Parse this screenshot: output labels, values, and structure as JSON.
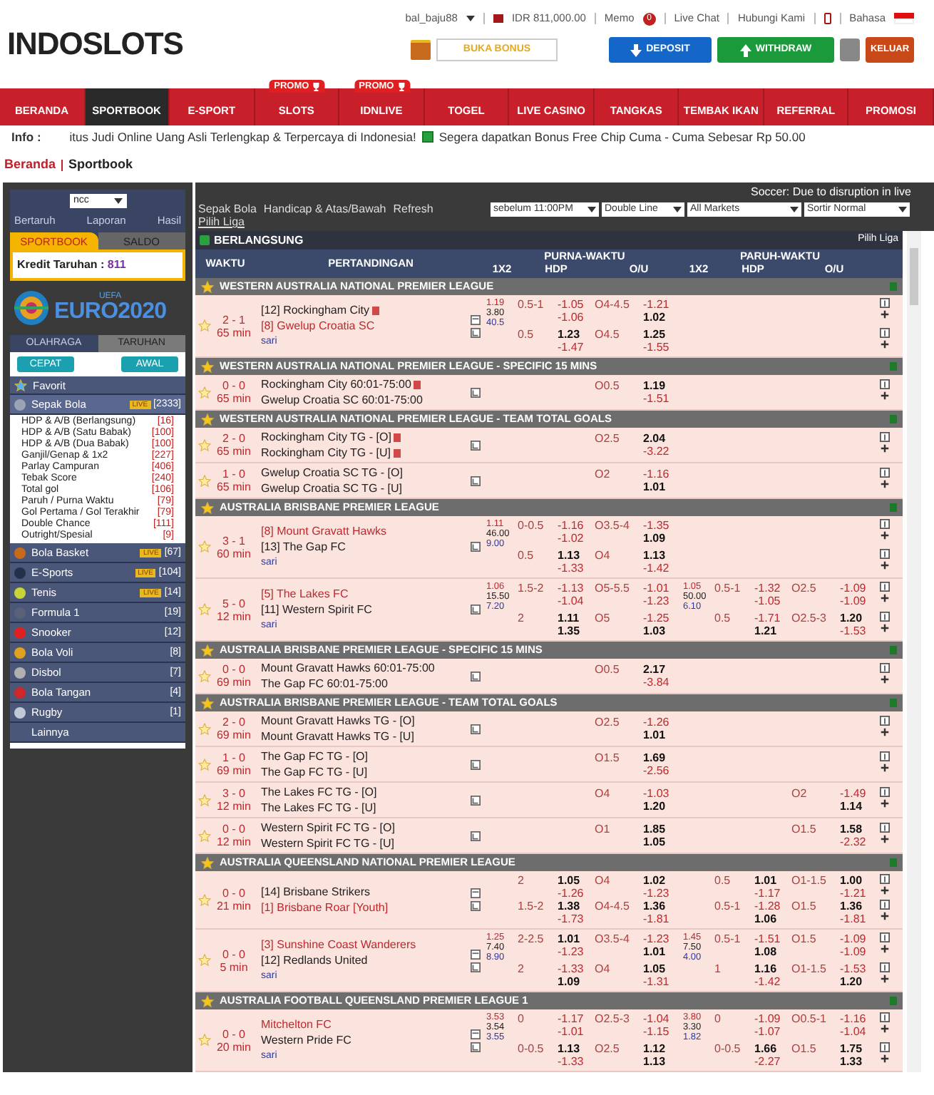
{
  "header": {
    "logo": "INDOSLOTS",
    "user": "bal_baju88",
    "balance": "IDR 811,000.00",
    "memo": {
      "label": "Memo",
      "count": "0"
    },
    "links": [
      "Live Chat",
      "Hubungi Kami"
    ],
    "language": "Bahasa",
    "bonus_button": "BUKA BONUS",
    "deposit_button": "DEPOSIT",
    "withdraw_button": "WITHDRAW",
    "logout_button": "KELUAR"
  },
  "nav": [
    {
      "label": "BERANDA",
      "selected": false
    },
    {
      "label": "SPORTBOOK",
      "selected": true
    },
    {
      "label": "E-SPORT",
      "selected": false
    },
    {
      "label": "SLOTS",
      "selected": false,
      "promo": "PROMO"
    },
    {
      "label": "IDNLIVE",
      "selected": false,
      "promo": "PROMO"
    },
    {
      "label": "TOGEL",
      "selected": false
    },
    {
      "label": "LIVE CASINO",
      "selected": false
    },
    {
      "label": "TANGKAS",
      "selected": false
    },
    {
      "label": "TEMBAK IKAN",
      "selected": false
    },
    {
      "label": "REFERRAL",
      "selected": false
    },
    {
      "label": "PROMOSI",
      "selected": false
    }
  ],
  "info": {
    "label": "Info :",
    "messages": [
      "itus Judi Online Uang Asli Terlengkap & Terpercaya di Indonesia!",
      "Segera dapatkan Bonus Free Chip Cuma - Cuma Sebesar Rp 50.00"
    ]
  },
  "breadcrumb": [
    "Beranda",
    "Sportbook"
  ],
  "sidebar": {
    "odds_type": "ncc",
    "links": [
      "Bertaruh",
      "Laporan",
      "Hasil"
    ],
    "tabs": [
      {
        "label": "SPORTBOOK",
        "selected": true
      },
      {
        "label": "SALDO",
        "selected": false
      }
    ],
    "credit_label": "Kredit Taruhan : ",
    "credit_value": "811",
    "banner": {
      "top": "UEFA",
      "title": "EURO2020"
    },
    "sport_tabs": [
      {
        "label": "OLAHRAGA",
        "selected": true
      },
      {
        "label": "TARUHAN",
        "selected": false
      }
    ],
    "buttons": [
      "CEPAT",
      "AWAL"
    ],
    "favorite": "Favorit",
    "sports": [
      {
        "name": "Sepak Bola",
        "live": "LIVE",
        "count": "[2333]",
        "color": "#9aa3b5",
        "expanded": true,
        "children": [
          {
            "name": "HDP & A/B (Berlangsung)",
            "count": "[16]"
          },
          {
            "name": "HDP & A/B (Satu Babak)",
            "count": "[100]"
          },
          {
            "name": "HDP & A/B (Dua Babak)",
            "count": "[100]"
          },
          {
            "name": "Ganjil/Genap & 1x2",
            "count": "[227]"
          },
          {
            "name": "Parlay Campuran",
            "count": "[406]"
          },
          {
            "name": "Tebak Score",
            "count": "[240]"
          },
          {
            "name": "Total gol",
            "count": "[106]"
          },
          {
            "name": "Paruh / Purna Waktu",
            "count": "[79]"
          },
          {
            "name": "Gol Pertama / Gol Terakhir",
            "count": "[79]"
          },
          {
            "name": "Double Chance",
            "count": "[111]"
          },
          {
            "name": "Outright/Spesial",
            "count": "[9]"
          }
        ]
      },
      {
        "name": "Bola Basket",
        "live": "LIVE",
        "count": "[67]",
        "color": "#c86a1c",
        "expanded": false
      },
      {
        "name": "E-Sports",
        "live": "LIVE",
        "count": "[104]",
        "color": "#22304a",
        "expanded": false
      },
      {
        "name": "Tenis",
        "live": "LIVE",
        "count": "[14]",
        "color": "#c8d43a",
        "expanded": false
      },
      {
        "name": "Formula 1",
        "count": "[19]",
        "color": "#5a6278",
        "expanded": false
      },
      {
        "name": "Snooker",
        "count": "[12]",
        "color": "#e02020",
        "expanded": false
      },
      {
        "name": "Bola Voli",
        "count": "[8]",
        "color": "#e0a020",
        "expanded": false
      },
      {
        "name": "Disbol",
        "count": "[7]",
        "color": "#b0b0b0",
        "expanded": false
      },
      {
        "name": "Bola Tangan",
        "count": "[4]",
        "color": "#d02828",
        "expanded": false
      },
      {
        "name": "Rugby",
        "count": "[1]",
        "color": "#c0c8d8",
        "expanded": false
      },
      {
        "name": "Lainnya",
        "expanded": false
      }
    ]
  },
  "main": {
    "notice": "Soccer: Due to disruption in live",
    "menu": [
      "Sepak Bola",
      "Handicap & Atas/Bawah",
      "Refresh"
    ],
    "pick_league": "Pilih Liga",
    "selects": [
      "sebelum 11:00PM",
      "Double Line",
      "All Markets",
      "Sortir Normal"
    ],
    "section": {
      "title": "BERLANGSUNG",
      "pick_league": "Pilih Liga"
    },
    "columns": {
      "time": "WAKTU",
      "match": "PERTANDINGAN",
      "full_time": "PURNA-WAKTU",
      "half_time": "PARUH-WAKTU",
      "full_time_sub": [
        "1X2",
        "HDP",
        "O/U"
      ],
      "half_time_sub": [
        "1X2",
        "HDP",
        "O/U"
      ]
    },
    "leagues": [
      {
        "name": "WESTERN AUSTRALIA NATIONAL PREMIER LEAGUE",
        "matches": [
          {
            "score": "2 - 1",
            "time": "65 min",
            "stream": true,
            "teams": [
              {
                "name": "[12] Rockingham City",
                "favorite": false,
                "red_card": true
              },
              {
                "name": "[8] Gwelup Croatia SC",
                "favorite": true,
                "red_card": false
              }
            ],
            "extra": "sari",
            "lines": [
              {
                "ft_1x2": [
                  "1.19",
                  "3.80",
                  "40.5"
                ],
                "ft_hdp": "0.5-1",
                "ft_hdp_odds": [
                  "-1.05",
                  "-1.06"
                ],
                "ft_ou": "O4-4.5",
                "ft_ou_odds": [
                  "-1.21",
                  "1.02"
                ]
              },
              {
                "ft_hdp": "0.5",
                "ft_hdp_odds": [
                  "1.23",
                  "-1.47"
                ],
                "ft_ou": "O4.5",
                "ft_ou_odds": [
                  "1.25",
                  "-1.55"
                ]
              }
            ]
          }
        ]
      },
      {
        "name": "WESTERN AUSTRALIA NATIONAL PREMIER LEAGUE - SPECIFIC 15 MINS",
        "matches": [
          {
            "score": "0 - 0",
            "time": "65 min",
            "stream": false,
            "teams": [
              {
                "name": "Rockingham City 60:01-75:00",
                "favorite": false,
                "red_card": true
              },
              {
                "name": "Gwelup Croatia SC 60:01-75:00",
                "favorite": false,
                "red_card": false
              }
            ],
            "lines": [
              {
                "ft_ou": "O0.5",
                "ft_ou_odds": [
                  "1.19",
                  "-1.51"
                ]
              }
            ]
          }
        ]
      },
      {
        "name": "WESTERN AUSTRALIA NATIONAL PREMIER LEAGUE - TEAM TOTAL GOALS",
        "matches": [
          {
            "score": "2 - 0",
            "time": "65 min",
            "stream": false,
            "teams": [
              {
                "name": "Rockingham City TG - [O]",
                "favorite": false,
                "red_card": true
              },
              {
                "name": "Rockingham City TG - [U]",
                "favorite": false,
                "red_card": true
              }
            ],
            "lines": [
              {
                "ft_ou": "O2.5",
                "ft_ou_odds": [
                  "2.04",
                  "-3.22"
                ]
              }
            ]
          },
          {
            "score": "1 - 0",
            "time": "65 min",
            "stream": false,
            "teams": [
              {
                "name": "Gwelup Croatia SC TG - [O]",
                "favorite": false,
                "red_card": false
              },
              {
                "name": "Gwelup Croatia SC TG - [U]",
                "favorite": false,
                "red_card": false
              }
            ],
            "lines": [
              {
                "ft_ou": "O2",
                "ft_ou_odds": [
                  "-1.16",
                  "1.01"
                ]
              }
            ]
          }
        ]
      },
      {
        "name": "AUSTRALIA BRISBANE PREMIER LEAGUE",
        "matches": [
          {
            "score": "3 - 1",
            "time": "60 min",
            "stream": false,
            "teams": [
              {
                "name": "[8] Mount Gravatt Hawks",
                "favorite": true,
                "red_card": false
              },
              {
                "name": "[13] The Gap FC",
                "favorite": false,
                "red_card": false
              }
            ],
            "extra": "sari",
            "lines": [
              {
                "ft_1x2": [
                  "1.11",
                  "46.00",
                  "9.00"
                ],
                "ft_hdp": "0-0.5",
                "ft_hdp_odds": [
                  "-1.16",
                  "-1.02"
                ],
                "ft_ou": "O3.5-4",
                "ft_ou_odds": [
                  "-1.35",
                  "1.09"
                ]
              },
              {
                "ft_hdp": "0.5",
                "ft_hdp_odds": [
                  "1.13",
                  "-1.33"
                ],
                "ft_ou": "O4",
                "ft_ou_odds": [
                  "1.13",
                  "-1.42"
                ]
              }
            ]
          },
          {
            "score": "5 - 0",
            "time": "12 min",
            "stream": false,
            "teams": [
              {
                "name": "[5] The Lakes FC",
                "favorite": true,
                "red_card": false
              },
              {
                "name": "[11] Western Spirit FC",
                "favorite": false,
                "red_card": false
              }
            ],
            "extra": "sari",
            "lines": [
              {
                "ft_1x2": [
                  "1.06",
                  "15.50",
                  "7.20"
                ],
                "ft_hdp": "1.5-2",
                "ft_hdp_odds": [
                  "-1.13",
                  "-1.04"
                ],
                "ft_ou": "O5-5.5",
                "ft_ou_odds": [
                  "-1.01",
                  "-1.23"
                ],
                "ht_1x2": [
                  "1.05",
                  "50.00",
                  "6.10"
                ],
                "ht_hdp": "0.5-1",
                "ht_hdp_odds": [
                  "-1.32",
                  "-1.05"
                ],
                "ht_ou": "O2.5",
                "ht_ou_odds": [
                  "-1.09",
                  "-1.09"
                ]
              },
              {
                "ft_hdp": "2",
                "ft_hdp_odds": [
                  "1.11",
                  "1.35"
                ],
                "ft_ou": "O5",
                "ft_ou_odds": [
                  "-1.25",
                  "1.03"
                ],
                "ht_hdp": "0.5",
                "ht_hdp_odds": [
                  "-1.71",
                  "1.21"
                ],
                "ht_ou": "O2.5-3",
                "ht_ou_odds": [
                  "1.20",
                  "-1.53"
                ]
              }
            ]
          }
        ]
      },
      {
        "name": "AUSTRALIA BRISBANE PREMIER LEAGUE - SPECIFIC 15 MINS",
        "matches": [
          {
            "score": "0 - 0",
            "time": "69 min",
            "stream": false,
            "teams": [
              {
                "name": "Mount Gravatt Hawks 60:01-75:00",
                "favorite": false,
                "red_card": false
              },
              {
                "name": "The Gap FC 60:01-75:00",
                "favorite": false,
                "red_card": false
              }
            ],
            "lines": [
              {
                "ft_ou": "O0.5",
                "ft_ou_odds": [
                  "2.17",
                  "-3.84"
                ]
              }
            ]
          }
        ]
      },
      {
        "name": "AUSTRALIA BRISBANE PREMIER LEAGUE - TEAM TOTAL GOALS",
        "matches": [
          {
            "score": "2 - 0",
            "time": "69 min",
            "stream": false,
            "teams": [
              {
                "name": "Mount Gravatt Hawks TG - [O]",
                "favorite": false,
                "red_card": false
              },
              {
                "name": "Mount Gravatt Hawks TG - [U]",
                "favorite": false,
                "red_card": false
              }
            ],
            "lines": [
              {
                "ft_ou": "O2.5",
                "ft_ou_odds": [
                  "-1.26",
                  "1.01"
                ]
              }
            ]
          },
          {
            "score": "1 - 0",
            "time": "69 min",
            "stream": false,
            "teams": [
              {
                "name": "The Gap FC TG - [O]",
                "favorite": false,
                "red_card": false
              },
              {
                "name": "The Gap FC TG - [U]",
                "favorite": false,
                "red_card": false
              }
            ],
            "lines": [
              {
                "ft_ou": "O1.5",
                "ft_ou_odds": [
                  "1.69",
                  "-2.56"
                ]
              }
            ]
          },
          {
            "score": "3 - 0",
            "time": "12 min",
            "stream": false,
            "teams": [
              {
                "name": "The Lakes FC TG - [O]",
                "favorite": false,
                "red_card": false
              },
              {
                "name": "The Lakes FC TG - [U]",
                "favorite": false,
                "red_card": false
              }
            ],
            "lines": [
              {
                "ft_ou": "O4",
                "ft_ou_odds": [
                  "-1.03",
                  "1.20"
                ],
                "ht_ou": "O2",
                "ht_ou_odds": [
                  "-1.49",
                  "1.14"
                ]
              }
            ]
          },
          {
            "score": "0 - 0",
            "time": "12 min",
            "stream": false,
            "teams": [
              {
                "name": "Western Spirit FC TG - [O]",
                "favorite": false,
                "red_card": false
              },
              {
                "name": "Western Spirit FC TG - [U]",
                "favorite": false,
                "red_card": false
              }
            ],
            "lines": [
              {
                "ft_ou": "O1",
                "ft_ou_odds": [
                  "1.85",
                  "1.05"
                ],
                "ht_ou": "O1.5",
                "ht_ou_odds": [
                  "1.58",
                  "-2.32"
                ]
              }
            ]
          }
        ]
      },
      {
        "name": "AUSTRALIA QUEENSLAND NATIONAL PREMIER LEAGUE",
        "matches": [
          {
            "score": "0 - 0",
            "time": "21 min",
            "stream": true,
            "teams": [
              {
                "name": "[14] Brisbane Strikers",
                "favorite": false,
                "red_card": false
              },
              {
                "name": "[1] Brisbane Roar [Youth]",
                "favorite": true,
                "red_card": false
              }
            ],
            "lines": [
              {
                "ft_hdp": "2",
                "ft_hdp_odds": [
                  "1.05",
                  "-1.26"
                ],
                "ft_ou": "O4",
                "ft_ou_odds": [
                  "1.02",
                  "-1.23"
                ],
                "ht_hdp": "0.5",
                "ht_hdp_odds": [
                  "1.01",
                  "-1.17"
                ],
                "ht_ou": "O1-1.5",
                "ht_ou_odds": [
                  "1.00",
                  "-1.21"
                ]
              },
              {
                "ft_hdp": "1.5-2",
                "ft_hdp_odds": [
                  "1.38",
                  "-1.73"
                ],
                "ft_ou": "O4-4.5",
                "ft_ou_odds": [
                  "1.36",
                  "-1.81"
                ],
                "ht_hdp": "0.5-1",
                "ht_hdp_odds": [
                  "-1.28",
                  "1.06"
                ],
                "ht_ou": "O1.5",
                "ht_ou_odds": [
                  "1.36",
                  "-1.81"
                ]
              }
            ]
          },
          {
            "score": "0 - 0",
            "time": "5 min",
            "stream": true,
            "teams": [
              {
                "name": "[3] Sunshine Coast Wanderers",
                "favorite": true,
                "red_card": false
              },
              {
                "name": "[12] Redlands United",
                "favorite": false,
                "red_card": false
              }
            ],
            "extra": "sari",
            "lines": [
              {
                "ft_1x2": [
                  "1.25",
                  "7.40",
                  "8.90"
                ],
                "ft_hdp": "2-2.5",
                "ft_hdp_odds": [
                  "1.01",
                  "-1.23"
                ],
                "ft_ou": "O3.5-4",
                "ft_ou_odds": [
                  "-1.23",
                  "1.01"
                ],
                "ht_1x2": [
                  "1.45",
                  "7.50",
                  "4.00"
                ],
                "ht_hdp": "0.5-1",
                "ht_hdp_odds": [
                  "-1.51",
                  "1.08"
                ],
                "ht_ou": "O1.5",
                "ht_ou_odds": [
                  "-1.09",
                  "-1.09"
                ]
              },
              {
                "ft_hdp": "2",
                "ft_hdp_odds": [
                  "-1.33",
                  "1.09"
                ],
                "ft_ou": "O4",
                "ft_ou_odds": [
                  "1.05",
                  "-1.31"
                ],
                "ht_hdp": "1",
                "ht_hdp_odds": [
                  "1.16",
                  "-1.42"
                ],
                "ht_ou": "O1-1.5",
                "ht_ou_odds": [
                  "-1.53",
                  "1.20"
                ]
              }
            ]
          }
        ]
      },
      {
        "name": "AUSTRALIA FOOTBALL QUEENSLAND PREMIER LEAGUE 1",
        "matches": [
          {
            "score": "0 - 0",
            "time": "20 min",
            "stream": true,
            "teams": [
              {
                "name": "Mitchelton FC",
                "favorite": true,
                "red_card": false
              },
              {
                "name": "Western Pride FC",
                "favorite": false,
                "red_card": false
              }
            ],
            "extra": "sari",
            "lines": [
              {
                "ft_1x2": [
                  "3.53",
                  "3.54",
                  "3.55"
                ],
                "ft_hdp": "0",
                "ft_hdp_odds": [
                  "-1.17",
                  "-1.01"
                ],
                "ft_ou": "O2.5-3",
                "ft_ou_odds": [
                  "-1.04",
                  "-1.15"
                ],
                "ht_1x2": [
                  "3.80",
                  "3.30",
                  "1.82"
                ],
                "ht_hdp": "0",
                "ht_hdp_odds": [
                  "-1.09",
                  "-1.07"
                ],
                "ht_ou": "O0.5-1",
                "ht_ou_odds": [
                  "-1.16",
                  "-1.04"
                ]
              },
              {
                "ft_hdp": "0-0.5",
                "ft_hdp_odds": [
                  "1.13",
                  "-1.33"
                ],
                "ft_ou": "O2.5",
                "ft_ou_odds": [
                  "1.12",
                  "1.13"
                ],
                "ht_hdp": "0-0.5",
                "ht_hdp_odds": [
                  "1.66",
                  "-2.27"
                ],
                "ht_ou": "O1.5",
                "ht_ou_odds": [
                  "1.75",
                  "1.33"
                ]
              }
            ]
          }
        ]
      }
    ]
  }
}
